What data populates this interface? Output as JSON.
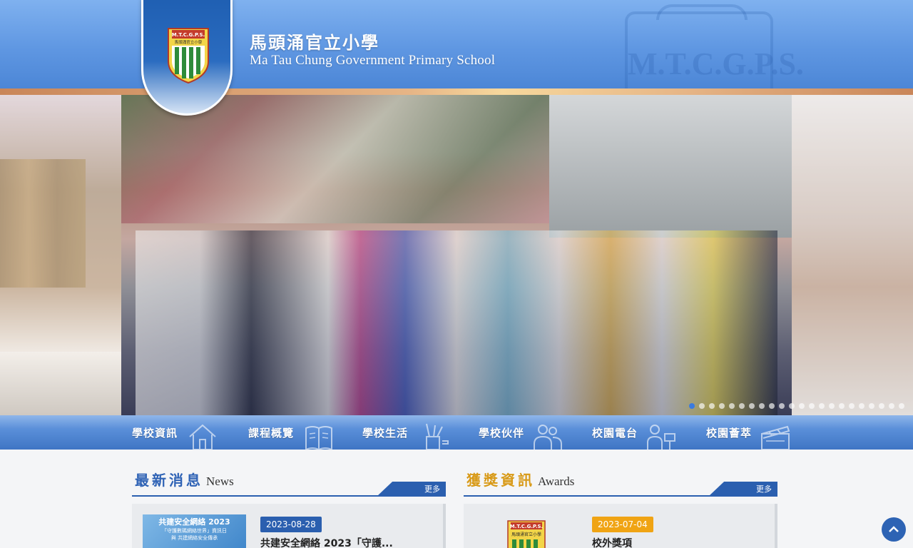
{
  "header": {
    "school_name_zh": "馬頭涌官立小學",
    "school_name_en": "Ma Tau Chung Government Primary School",
    "watermark_text": "M.T.C.G.P.S.",
    "logo": {
      "abbr": "M.T.C.G.P.S.",
      "name_zh": "馬頭涌官立小學"
    },
    "colors": {
      "header_blue": "#5f97e2",
      "stripe_gold": "#e6b586"
    }
  },
  "slider": {
    "total_slides": 22,
    "active_slide": 1,
    "dot_active_color": "#3a7be0"
  },
  "nav": {
    "items": [
      {
        "label": "學校資訊",
        "icon": "house-icon"
      },
      {
        "label": "課程概覽",
        "icon": "open-book-icon"
      },
      {
        "label": "學校生活",
        "icon": "pencil-cup-icon"
      },
      {
        "label": "學校伙伴",
        "icon": "people-icon"
      },
      {
        "label": "校園電台",
        "icon": "presenter-icon"
      },
      {
        "label": "校園薈萃",
        "icon": "clapperboard-icon"
      }
    ]
  },
  "news": {
    "title_zh": "最新消息",
    "title_en": "News",
    "more_label": "更多",
    "items": [
      {
        "date": "2023-08-28",
        "title": "共建安全網絡 2023「守護...",
        "thumb_line1": "共建安全網絡 2023",
        "thumb_line2": "「守護數碼網絡世界」資訊日",
        "thumb_line3": "與 共建網絡安全傳承"
      }
    ]
  },
  "awards": {
    "title_zh": "獲獎資訊",
    "title_en": "Awards",
    "more_label": "更多",
    "items": [
      {
        "date": "2023-07-04",
        "title": "校外獎項"
      }
    ]
  },
  "back_to_top": {
    "icon": "chevron-up-icon"
  }
}
